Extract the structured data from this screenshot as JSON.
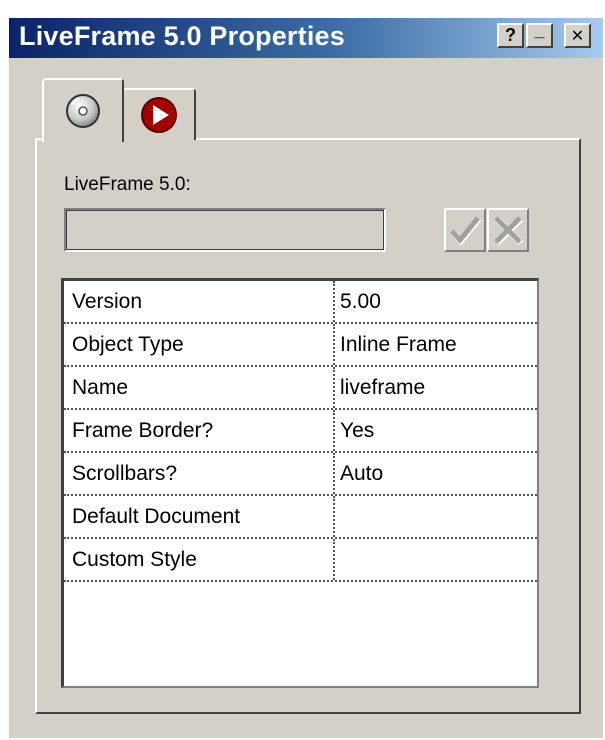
{
  "window": {
    "title": "LiveFrame 5.0 Properties",
    "help_glyph": "?",
    "minimize_glyph": "_",
    "close_glyph": "✕"
  },
  "tabs": [
    {
      "icon": "disc-icon",
      "selected": true
    },
    {
      "icon": "play-icon",
      "selected": false
    }
  ],
  "form": {
    "label": "LiveFrame 5.0:",
    "input_value": "",
    "apply_icon": "checkmark-icon",
    "cancel_icon": "x-icon"
  },
  "properties": [
    {
      "name": "Version",
      "value": "5.00"
    },
    {
      "name": "Object Type",
      "value": "Inline Frame"
    },
    {
      "name": "Name",
      "value": "liveframe"
    },
    {
      "name": "Frame Border?",
      "value": "Yes"
    },
    {
      "name": "Scrollbars?",
      "value": "Auto"
    },
    {
      "name": "Default Document",
      "value": ""
    },
    {
      "name": "Custom Style",
      "value": ""
    }
  ],
  "colors": {
    "titlebar_start": "#0a246a",
    "titlebar_end": "#a6caf0",
    "face": "#d4d0c8",
    "play_icon": "#a40000"
  }
}
